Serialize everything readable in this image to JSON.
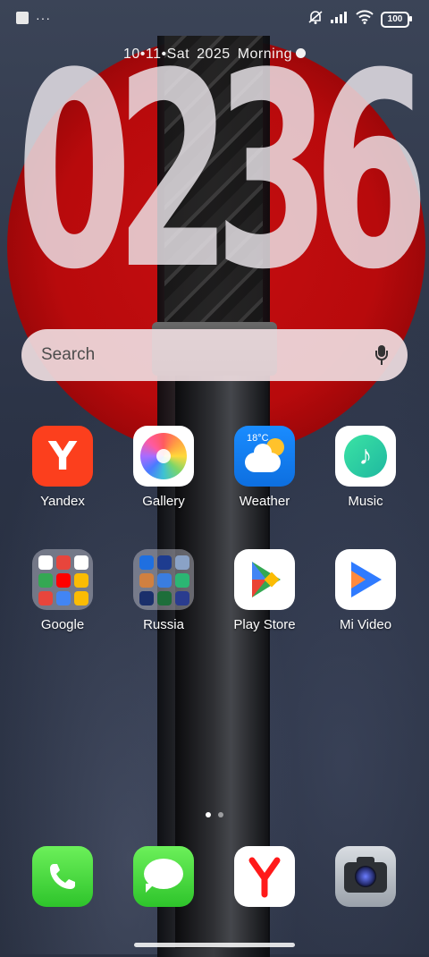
{
  "status_bar": {
    "dots": "···",
    "battery": "100"
  },
  "lockscreen": {
    "date": "10•11•Sat",
    "year": "2025",
    "greeting": "Morning",
    "time": "0236"
  },
  "search": {
    "placeholder": "Search"
  },
  "apps": {
    "row1": [
      {
        "label": "Yandex",
        "icon": "yandex-icon"
      },
      {
        "label": "Gallery",
        "icon": "gallery-icon"
      },
      {
        "label": "Weather",
        "icon": "weather-icon",
        "temp": "18°C"
      },
      {
        "label": "Music",
        "icon": "music-icon"
      }
    ],
    "row2": [
      {
        "label": "Google",
        "icon": "google-folder-icon"
      },
      {
        "label": "Russia",
        "icon": "russia-folder-icon"
      },
      {
        "label": "Play Store",
        "icon": "play-store-icon"
      },
      {
        "label": "Mi Video",
        "icon": "mi-video-icon"
      }
    ]
  },
  "dock": [
    {
      "name": "Phone",
      "icon": "phone-icon"
    },
    {
      "name": "Messages",
      "icon": "messages-icon"
    },
    {
      "name": "Yandex Browser",
      "icon": "yandex-browser-icon"
    },
    {
      "name": "Camera",
      "icon": "camera-icon"
    }
  ],
  "pagination": {
    "pages": 2,
    "current": 1
  },
  "colors": {
    "sun_red": "#c50e10",
    "yandex_red": "#fc3f1d",
    "weather_blue": "#1a8cff",
    "phone_green": "#2ec42b"
  }
}
